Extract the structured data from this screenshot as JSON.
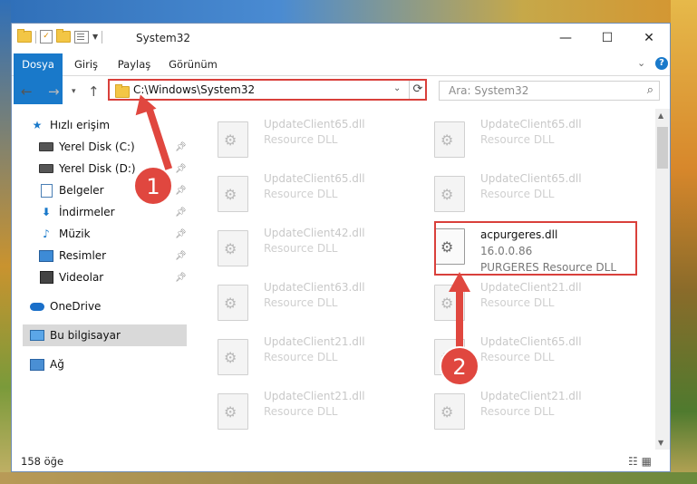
{
  "window": {
    "title": "System32",
    "controls": {
      "minimize": "—",
      "maximize": "☐",
      "close": "✕"
    }
  },
  "ribbon": {
    "tabs": [
      "Dosya",
      "Giriş",
      "Paylaş",
      "Görünüm"
    ]
  },
  "nav": {
    "address_path": "C:\\Windows\\System32",
    "search_placeholder": "Ara: System32"
  },
  "sidebar": {
    "items": [
      {
        "label": "Hızlı erişim",
        "icon": "star-icon"
      },
      {
        "label": "Yerel Disk (C:)",
        "icon": "drive-icon",
        "pinned": true
      },
      {
        "label": "Yerel Disk (D:)",
        "icon": "drive-icon",
        "pinned": true
      },
      {
        "label": "Belgeler",
        "icon": "document-icon",
        "pinned": true
      },
      {
        "label": "İndirmeler",
        "icon": "download-icon",
        "pinned": true
      },
      {
        "label": "Müzik",
        "icon": "music-icon",
        "pinned": true
      },
      {
        "label": "Resimler",
        "icon": "pictures-icon",
        "pinned": true
      },
      {
        "label": "Videolar",
        "icon": "videos-icon",
        "pinned": true
      },
      {
        "label": "OneDrive",
        "icon": "cloud-icon"
      },
      {
        "label": "Bu bilgisayar",
        "icon": "computer-icon",
        "selected": true
      },
      {
        "label": "Ağ",
        "icon": "network-icon"
      }
    ]
  },
  "files": {
    "left": [
      {
        "name": "UpdateClient65.dll",
        "desc": "Resource DLL"
      },
      {
        "name": "UpdateClient65.dll",
        "desc": "Resource DLL"
      },
      {
        "name": "UpdateClient42.dll",
        "desc": "Resource DLL"
      },
      {
        "name": "UpdateClient63.dll",
        "desc": "Resource DLL"
      },
      {
        "name": "UpdateClient21.dll",
        "desc": "Resource DLL"
      },
      {
        "name": "UpdateClient21.dll",
        "desc": "Resource DLL"
      }
    ],
    "right": [
      {
        "name": "UpdateClient65.dll",
        "desc": "Resource DLL"
      },
      {
        "name": "UpdateClient65.dll",
        "desc": "Resource DLL"
      },
      {
        "name": "acpurgeres.dll",
        "version": "16.0.0.86",
        "desc": "PURGERES Resource DLL",
        "target": true
      },
      {
        "name": "UpdateClient21.dll",
        "desc": "Resource DLL"
      },
      {
        "name": "UpdateClient65.dll",
        "desc": "Resource DLL"
      },
      {
        "name": "UpdateClient21.dll",
        "desc": "Resource DLL"
      }
    ]
  },
  "status": {
    "item_count": "158 öğe"
  },
  "annotations": {
    "step1": "1",
    "step2": "2"
  },
  "colors": {
    "accent": "#1979ca",
    "annotation": "#e0473f"
  }
}
